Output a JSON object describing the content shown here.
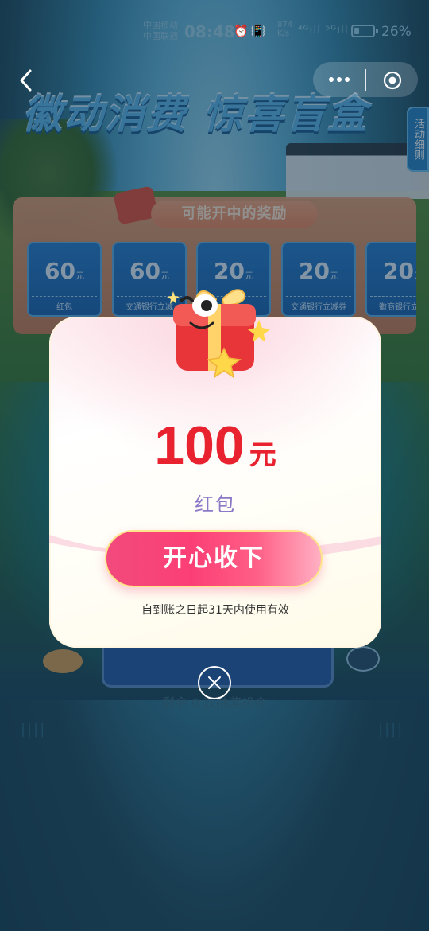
{
  "status_bar": {
    "carrier_1": "中国移动",
    "carrier_2": "中国联通",
    "time": "08:48",
    "net_speed_value": "874",
    "net_speed_unit": "K/s",
    "battery_percent": "26%",
    "battery_level": 0.26
  },
  "background": {
    "banner_title": "徽动消费 惊喜盲盒",
    "side_tab_label": "活动细则",
    "prize_section_title": "可能开中的奖励",
    "prizes": [
      {
        "amount": "60",
        "unit": "元",
        "label": "红包"
      },
      {
        "amount": "60",
        "unit": "元",
        "label": "交通银行立减"
      },
      {
        "amount": "20",
        "unit": "元",
        "label": ""
      },
      {
        "amount": "20",
        "unit": "元",
        "label": "交通银行立减券"
      },
      {
        "amount": "20",
        "unit": "元",
        "label": "徽商银行立减"
      }
    ],
    "remaining_text": "剩余 0 次抽奖机会",
    "ticks_left": "||||",
    "ticks_right": "||||"
  },
  "modal": {
    "amount": "100",
    "unit": "元",
    "prize_name": "红包",
    "accept_button_label": "开心收下",
    "validity_text": "自到账之日起31天内使用有效"
  },
  "colors": {
    "amount_red": "#e8222e",
    "prize_name_purple": "#8b78c7",
    "button_pink": "#fb3f76",
    "button_border_gold": "#ffe58a"
  },
  "icons": {
    "back": "chevron-left-icon",
    "more": "more-dots-icon",
    "close_mini_program": "close-circle-icon",
    "modal_close": "close-circle-icon",
    "gift": "gift-box-icon"
  }
}
